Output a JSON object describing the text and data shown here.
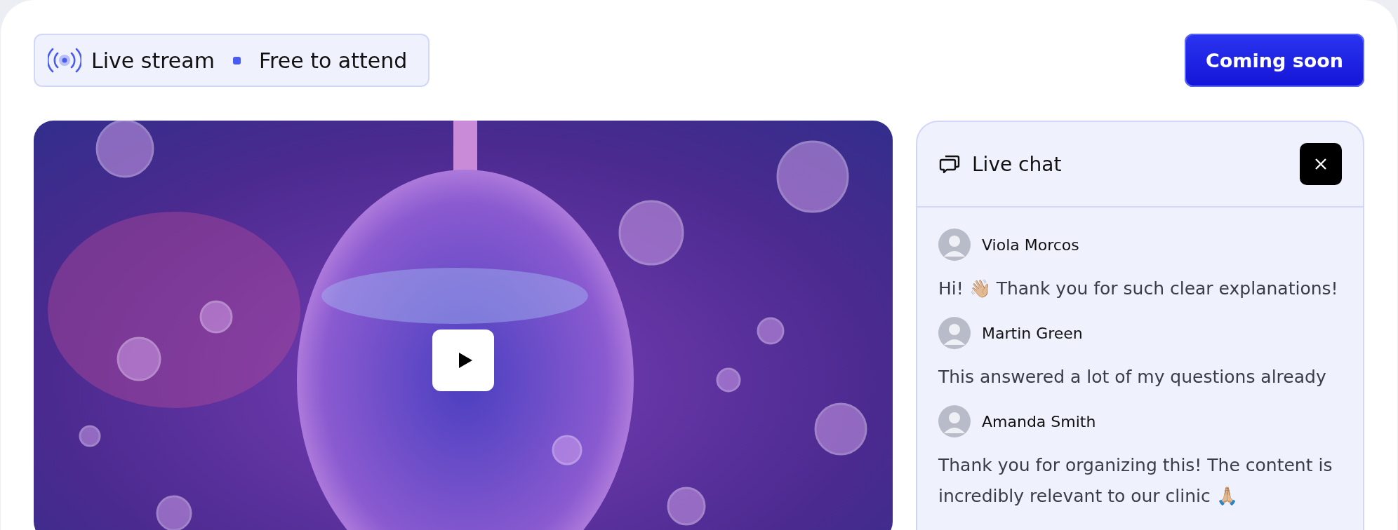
{
  "badge": {
    "items": [
      "Live stream",
      "Free to attend"
    ]
  },
  "action_button": {
    "label": "Coming soon"
  },
  "chat": {
    "title": "Live chat",
    "messages": [
      {
        "author": "Viola Morcos",
        "text": "Hi! 👋🏼 Thank you for such clear explanations!"
      },
      {
        "author": "Martin Green",
        "text": "This answered a lot of my questions already"
      },
      {
        "author": "Amanda Smith",
        "text": "Thank you for organizing this! The content is incredibly relevant to our clinic 🙏🏼"
      }
    ]
  }
}
